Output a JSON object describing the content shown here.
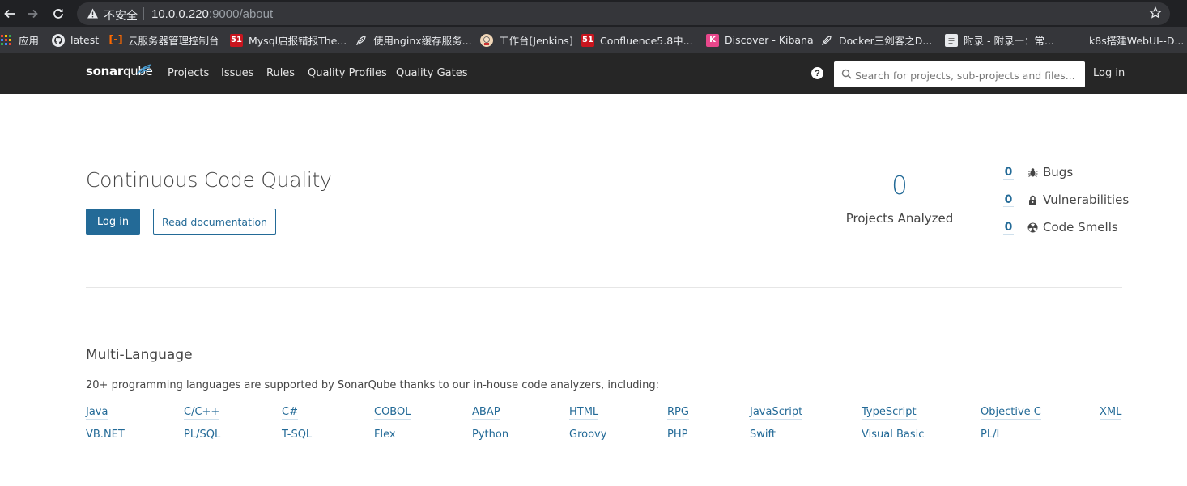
{
  "browser": {
    "insecure_label": "不安全",
    "url_host": "10.0.0.220",
    "url_path": ":9000/about",
    "bookmarks": [
      {
        "label": "应用",
        "icon": "apps-grid-icon"
      },
      {
        "label": "latest",
        "icon": "github-icon"
      },
      {
        "label": "云服务器管理控制台",
        "icon": "aliyun-icon"
      },
      {
        "label": "Mysql启报错报The...",
        "icon": "site-51-icon"
      },
      {
        "label": "使用nginx缓存服务...",
        "icon": "feather-icon"
      },
      {
        "label": "工作台[Jenkins]",
        "icon": "jenkins-icon"
      },
      {
        "label": "Confluence5.8中...",
        "icon": "site-51-icon"
      },
      {
        "label": "Discover - Kibana",
        "icon": "kibana-icon"
      },
      {
        "label": "Docker三剑客之D...",
        "icon": "feather-icon"
      },
      {
        "label": "附录 - 附录一：常...",
        "icon": "page-icon"
      },
      {
        "label": "k8s搭建WebUI--D...",
        "icon": "blank-icon"
      }
    ]
  },
  "navbar": {
    "logo_bold": "sonar",
    "logo_light": "qube",
    "links": [
      "Projects",
      "Issues",
      "Rules",
      "Quality Profiles",
      "Quality Gates"
    ],
    "search_placeholder": "Search for projects, sub-projects and files...",
    "login": "Log in"
  },
  "hero": {
    "title": "Continuous Code Quality",
    "login_button": "Log in",
    "docs_button": "Read documentation"
  },
  "stats": {
    "projects_count": "0",
    "projects_label": "Projects Analyzed",
    "bugs_count": "0",
    "bugs_label": "Bugs",
    "vulns_count": "0",
    "vulns_label": "Vulnerabilities",
    "smells_count": "0",
    "smells_label": "Code Smells"
  },
  "multi_language": {
    "title": "Multi-Language",
    "description": "20+ programming languages are supported by SonarQube thanks to our in-house code analyzers, including:",
    "row1": [
      "Java",
      "C/C++",
      "C#",
      "COBOL",
      "ABAP",
      "HTML",
      "RPG",
      "JavaScript",
      "TypeScript",
      "Objective C",
      "XML"
    ],
    "row2": [
      "VB.NET",
      "PL/SQL",
      "T-SQL",
      "Flex",
      "Python",
      "Groovy",
      "PHP",
      "Swift",
      "Visual Basic",
      "PL/I"
    ]
  },
  "colors": {
    "navbar_bg": "#262626",
    "accent_blue": "#236a97",
    "text": "#444444",
    "divider": "#e6e6e6"
  }
}
